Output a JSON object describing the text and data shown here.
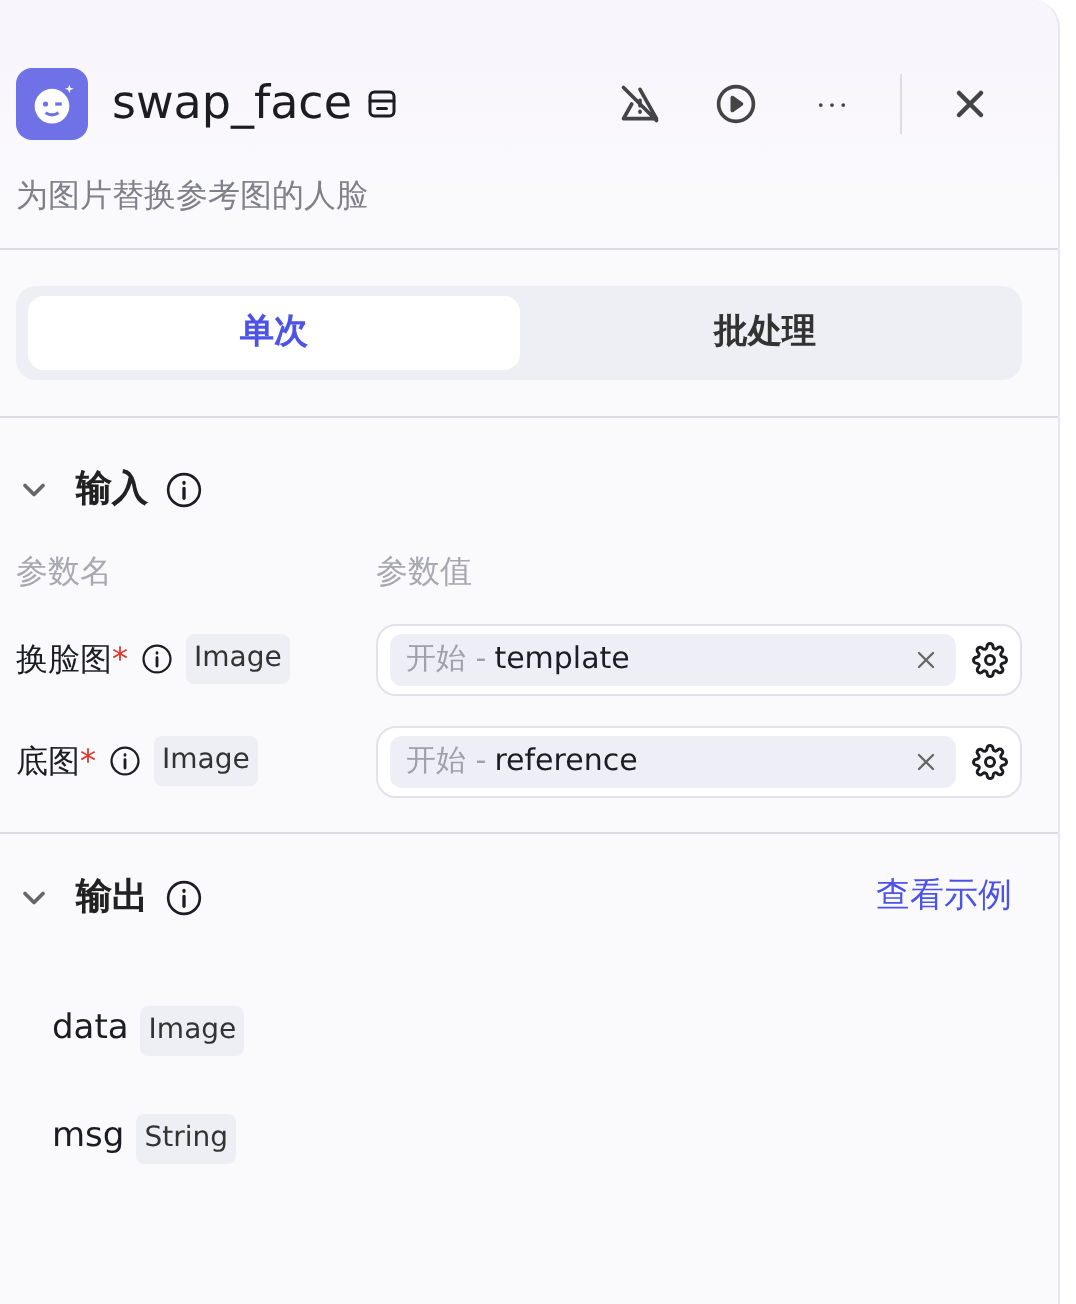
{
  "node": {
    "title": "swap_face",
    "description": "为图片替换参考图的人脸"
  },
  "tabs": [
    {
      "label": "单次",
      "selected": true
    },
    {
      "label": "批处理",
      "selected": false
    }
  ],
  "input_section": {
    "title": "输入",
    "expanded": true,
    "columns": [
      "参数名",
      "参数值"
    ],
    "params": [
      {
        "name": "换脸图",
        "required": true,
        "required_mark": "*",
        "type": "Image",
        "source": "开始 -",
        "value": "template"
      },
      {
        "name": "底图",
        "required": true,
        "required_mark": "*",
        "type": "Image",
        "source": "开始 -",
        "value": "reference"
      }
    ]
  },
  "output_section": {
    "title": "输出",
    "expanded": true,
    "link": "查看示例",
    "outputs": [
      {
        "name": "data",
        "type": "Image"
      },
      {
        "name": "msg",
        "type": "String"
      }
    ]
  }
}
